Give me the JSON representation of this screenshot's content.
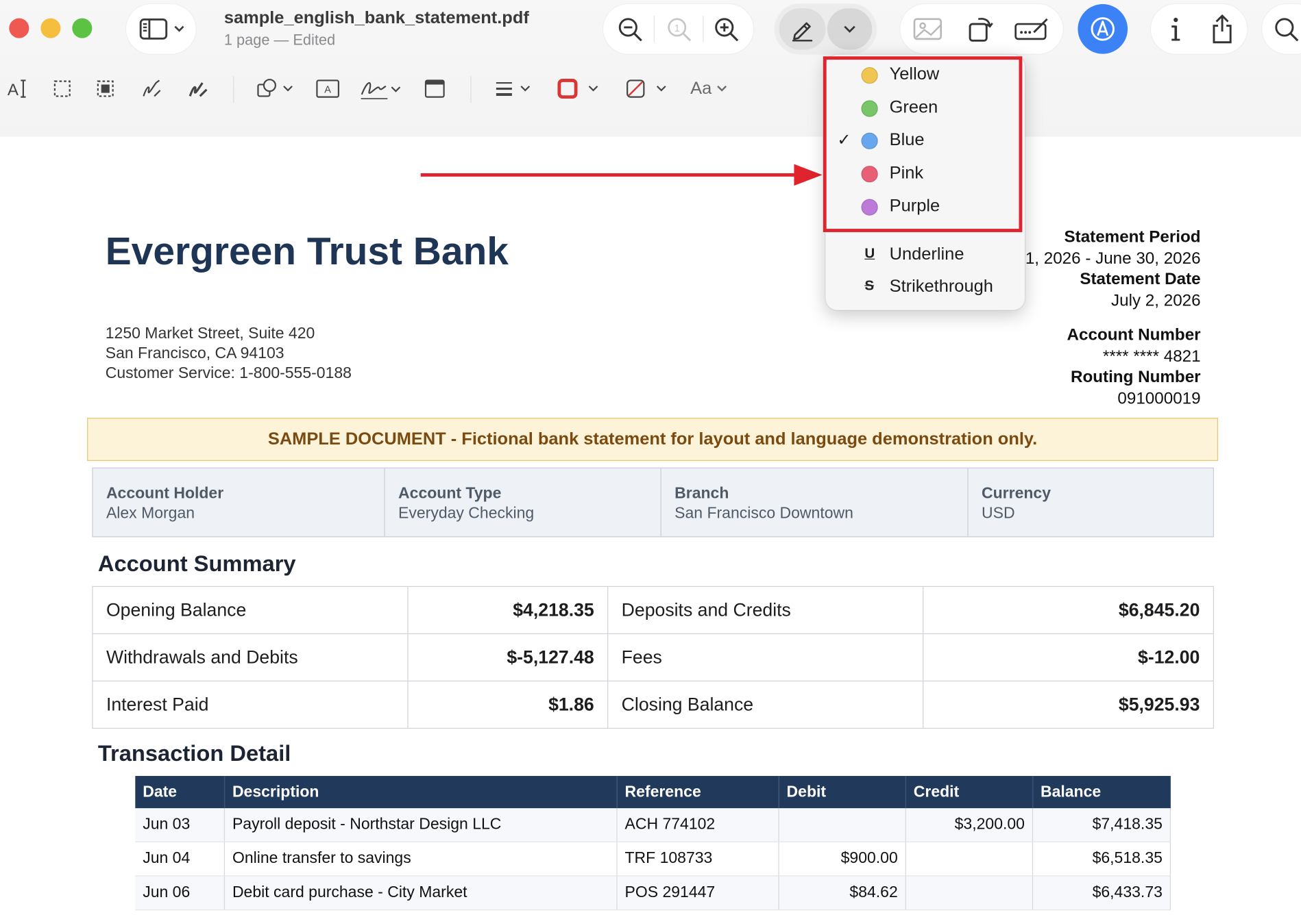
{
  "window": {
    "file_name": "sample_english_bank_statement.pdf",
    "subtitle": "1 page — Edited"
  },
  "toolbar": {
    "font_button_label": "Aa"
  },
  "highlight_menu": {
    "colors": [
      {
        "label": "Yellow",
        "color": "#f0c552",
        "checked": false
      },
      {
        "label": "Green",
        "color": "#79c56a",
        "checked": false
      },
      {
        "label": "Blue",
        "color": "#68a7ee",
        "checked": true
      },
      {
        "label": "Pink",
        "color": "#e86076",
        "checked": false
      },
      {
        "label": "Purple",
        "color": "#bc7ad9",
        "checked": false
      }
    ],
    "styles": [
      {
        "label": "Underline",
        "glyph": "U"
      },
      {
        "label": "Strikethrough",
        "glyph": "S"
      }
    ],
    "check_mark": "✓"
  },
  "document": {
    "bank_name": "Evergreen Trust Bank",
    "address": [
      "1250 Market Street, Suite 420",
      "San Francisco, CA 94103",
      "Customer Service: 1-800-555-0188"
    ],
    "statement_period_label": "Statement Period",
    "statement_period_value": "June 1, 2026 - June 30, 2026",
    "statement_date_label": "Statement Date",
    "statement_date_value": "July 2, 2026",
    "account_number_label": "Account Number",
    "account_number_value": "**** **** 4821",
    "routing_number_label": "Routing Number",
    "routing_number_value": "091000019",
    "banner": "SAMPLE DOCUMENT - Fictional bank statement for layout and language demonstration only.",
    "info": [
      {
        "label": "Account Holder",
        "value": "Alex Morgan"
      },
      {
        "label": "Account Type",
        "value": "Everyday Checking"
      },
      {
        "label": "Branch",
        "value": "San Francisco Downtown"
      },
      {
        "label": "Currency",
        "value": "USD"
      }
    ],
    "summary_title": "Account Summary",
    "summary": [
      {
        "l1": "Opening Balance",
        "v1": "$4,218.35",
        "l2": "Deposits and Credits",
        "v2": "$6,845.20"
      },
      {
        "l1": "Withdrawals and Debits",
        "v1": "$-5,127.48",
        "l2": "Fees",
        "v2": "$-12.00"
      },
      {
        "l1": "Interest Paid",
        "v1": "$1.86",
        "l2": "Closing Balance",
        "v2": "$5,925.93"
      }
    ],
    "transactions_title": "Transaction Detail",
    "tx_headers": [
      "Date",
      "Description",
      "Reference",
      "Debit",
      "Credit",
      "Balance"
    ],
    "transactions": [
      {
        "date": "Jun 03",
        "desc": "Payroll deposit - Northstar Design LLC",
        "ref": "ACH 774102",
        "debit": "",
        "credit": "$3,200.00",
        "balance": "$7,418.35"
      },
      {
        "date": "Jun 04",
        "desc": "Online transfer to savings",
        "ref": "TRF 108733",
        "debit": "$900.00",
        "credit": "",
        "balance": "$6,518.35"
      },
      {
        "date": "Jun 06",
        "desc": "Debit card purchase - City Market",
        "ref": "POS 291447",
        "debit": "$84.62",
        "credit": "",
        "balance": "$6,433.73"
      }
    ]
  }
}
